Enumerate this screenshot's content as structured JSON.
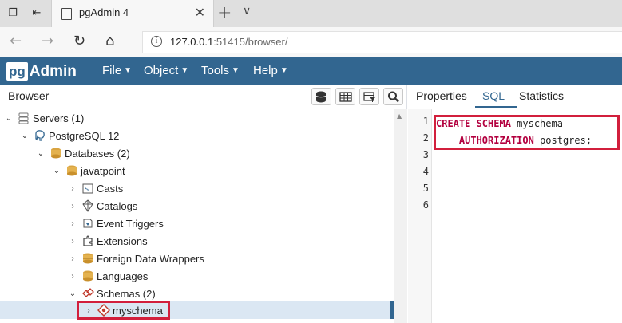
{
  "browser": {
    "tab_title": "pgAdmin 4",
    "url_host": "127.0.0.1",
    "url_rest": ":51415/browser/"
  },
  "app": {
    "logo_pg": "pg",
    "logo_admin": "Admin",
    "menu": [
      "File",
      "Object",
      "Tools",
      "Help"
    ]
  },
  "browser_panel": {
    "title": "Browser",
    "tree": [
      {
        "label": "Servers (1)",
        "icon": "servers-icon"
      },
      {
        "label": "PostgreSQL 12",
        "icon": "elephant-icon"
      },
      {
        "label": "Databases (2)",
        "icon": "databases-icon"
      },
      {
        "label": "javatpoint",
        "icon": "database-icon"
      },
      {
        "label": "Casts",
        "icon": "casts-icon"
      },
      {
        "label": "Catalogs",
        "icon": "catalogs-icon"
      },
      {
        "label": "Event Triggers",
        "icon": "event-triggers-icon"
      },
      {
        "label": "Extensions",
        "icon": "extensions-icon"
      },
      {
        "label": "Foreign Data Wrappers",
        "icon": "fdw-icon"
      },
      {
        "label": "Languages",
        "icon": "languages-icon"
      },
      {
        "label": "Schemas (2)",
        "icon": "schemas-icon"
      },
      {
        "label": "myschema",
        "icon": "schema-icon"
      }
    ]
  },
  "sql_panel": {
    "tabs": [
      "Properties",
      "SQL",
      "Statistics"
    ],
    "active_tab": "SQL",
    "line_numbers": [
      "1",
      "2",
      "3",
      "4",
      "5",
      "6"
    ],
    "line1_kw": "CREATE SCHEMA",
    "line1_rest": " myschema",
    "line2_indent": "    ",
    "line2_kw": "AUTHORIZATION",
    "line2_rest": " postgres;"
  },
  "colors": {
    "brand": "#326690",
    "highlight_box": "#d21f3c",
    "sql_keyword": "#b3003f"
  }
}
